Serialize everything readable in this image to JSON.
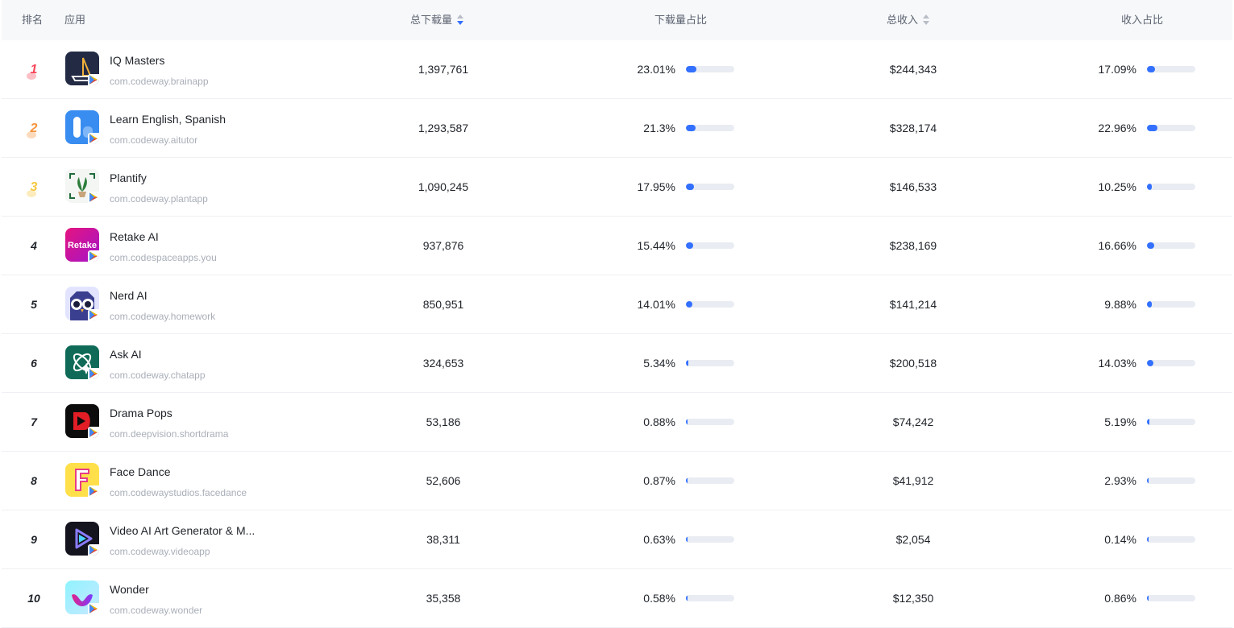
{
  "headers": {
    "rank": "排名",
    "app": "应用",
    "downloads": "总下载量",
    "download_share": "下载量占比",
    "revenue": "总收入",
    "revenue_share": "收入占比"
  },
  "colors": {
    "accent": "#3370ff",
    "bar_track": "#e9ecf2",
    "rank1": "#f5475b",
    "rank2": "#f5953d",
    "rank3": "#f5c842"
  },
  "rows": [
    {
      "rank": "1",
      "name": "IQ Masters",
      "pkg": "com.codeway.brainapp",
      "icon": "sailboat-app-icon",
      "downloads": "1,397,761",
      "dl_share": "23.01%",
      "dl_frac": 0.2301,
      "revenue": "$244,343",
      "rev_share": "17.09%",
      "rev_frac": 0.1709
    },
    {
      "rank": "2",
      "name": "Learn English, Spanish",
      "pkg": "com.codeway.aitutor",
      "icon": "tutor-app-icon",
      "downloads": "1,293,587",
      "dl_share": "21.3%",
      "dl_frac": 0.213,
      "revenue": "$328,174",
      "rev_share": "22.96%",
      "rev_frac": 0.2296
    },
    {
      "rank": "3",
      "name": "Plantify",
      "pkg": "com.codeway.plantapp",
      "icon": "plant-app-icon",
      "downloads": "1,090,245",
      "dl_share": "17.95%",
      "dl_frac": 0.1795,
      "revenue": "$146,533",
      "rev_share": "10.25%",
      "rev_frac": 0.1025
    },
    {
      "rank": "4",
      "name": "Retake AI",
      "pkg": "com.codespaceapps.you",
      "icon": "retake-app-icon",
      "icon_text": "Retake",
      "downloads": "937,876",
      "dl_share": "15.44%",
      "dl_frac": 0.1544,
      "revenue": "$238,169",
      "rev_share": "16.66%",
      "rev_frac": 0.1666
    },
    {
      "rank": "5",
      "name": "Nerd AI",
      "pkg": "com.codeway.homework",
      "icon": "owl-app-icon",
      "downloads": "850,951",
      "dl_share": "14.01%",
      "dl_frac": 0.1401,
      "revenue": "$141,214",
      "rev_share": "9.88%",
      "rev_frac": 0.0988
    },
    {
      "rank": "6",
      "name": "Ask AI",
      "pkg": "com.codeway.chatapp",
      "icon": "chat-ai-app-icon",
      "downloads": "324,653",
      "dl_share": "5.34%",
      "dl_frac": 0.0534,
      "revenue": "$200,518",
      "rev_share": "14.03%",
      "rev_frac": 0.1403
    },
    {
      "rank": "7",
      "name": "Drama Pops",
      "pkg": "com.deepvision.shortdrama",
      "icon": "drama-play-app-icon",
      "downloads": "53,186",
      "dl_share": "0.88%",
      "dl_frac": 0.0088,
      "revenue": "$74,242",
      "rev_share": "5.19%",
      "rev_frac": 0.0519
    },
    {
      "rank": "8",
      "name": "Face Dance",
      "pkg": "com.codewaystudios.facedance",
      "icon": "letter-f-app-icon",
      "downloads": "52,606",
      "dl_share": "0.87%",
      "dl_frac": 0.0087,
      "revenue": "$41,912",
      "rev_share": "2.93%",
      "rev_frac": 0.0293
    },
    {
      "rank": "9",
      "name": "Video AI Art Generator & M...",
      "pkg": "com.codeway.videoapp",
      "icon": "video-play-app-icon",
      "downloads": "38,311",
      "dl_share": "0.63%",
      "dl_frac": 0.0063,
      "revenue": "$2,054",
      "rev_share": "0.14%",
      "rev_frac": 0.0014
    },
    {
      "rank": "10",
      "name": "Wonder",
      "pkg": "com.codeway.wonder",
      "icon": "wonder-app-icon",
      "downloads": "35,358",
      "dl_share": "0.58%",
      "dl_frac": 0.0058,
      "revenue": "$12,350",
      "rev_share": "0.86%",
      "rev_frac": 0.0086
    }
  ]
}
